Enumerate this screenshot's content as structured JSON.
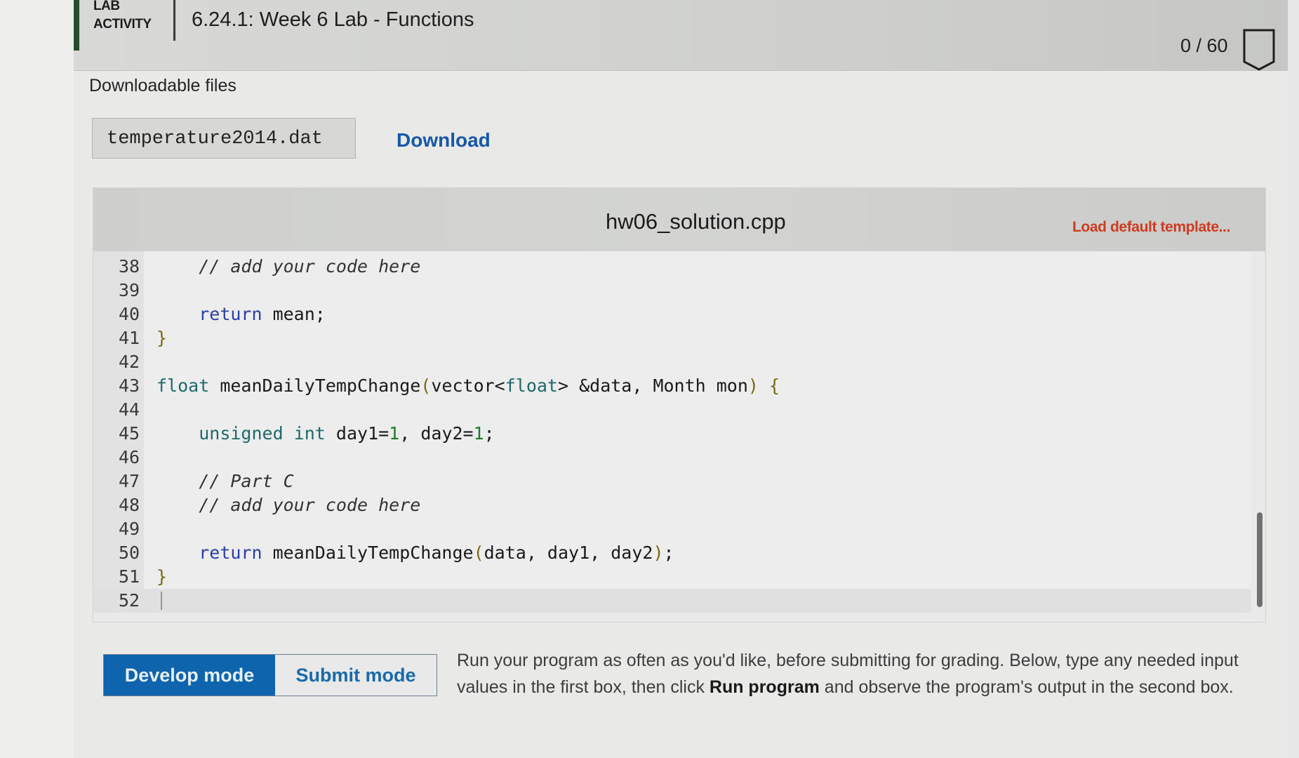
{
  "header": {
    "lab_label_line1": "LAB",
    "lab_label_line2": "ACTIVITY",
    "title": "6.24.1: Week 6 Lab - Functions",
    "score": "0 / 60",
    "score_icon": "badge-shield-icon"
  },
  "downloads": {
    "heading": "Downloadable files",
    "files": [
      {
        "name": "temperature2014.dat",
        "action_label": "Download"
      }
    ]
  },
  "editor": {
    "filename": "hw06_solution.cpp",
    "load_template_label": "Load default template...",
    "lines": [
      {
        "n": "38",
        "text": "    // add your code here"
      },
      {
        "n": "39",
        "text": ""
      },
      {
        "n": "40",
        "text": "    return mean;"
      },
      {
        "n": "41",
        "text": "}"
      },
      {
        "n": "42",
        "text": ""
      },
      {
        "n": "43",
        "text": "float meanDailyTempChange(vector<float> &data, Month mon) {"
      },
      {
        "n": "44",
        "text": ""
      },
      {
        "n": "45",
        "text": "    unsigned int day1=1, day2=1;"
      },
      {
        "n": "46",
        "text": ""
      },
      {
        "n": "47",
        "text": "    // Part C"
      },
      {
        "n": "48",
        "text": "    // add your code here"
      },
      {
        "n": "49",
        "text": ""
      },
      {
        "n": "50",
        "text": "    return meanDailyTempChange(data, day1, day2);"
      },
      {
        "n": "51",
        "text": "}"
      },
      {
        "n": "52",
        "text": ""
      }
    ],
    "active_line": "52"
  },
  "mode": {
    "develop_label": "Develop mode",
    "submit_label": "Submit mode",
    "selected": "Develop mode"
  },
  "instructions": {
    "part1": "Run your program as often as you'd like, before submitting for grading. Below, type any needed input values in the first box, then click ",
    "bold": "Run program",
    "part2": " and observe the program's output in the second box."
  },
  "colors": {
    "accent_blue": "#0f65ad",
    "link_blue": "#1557a8",
    "template_red": "#cf3b21"
  }
}
